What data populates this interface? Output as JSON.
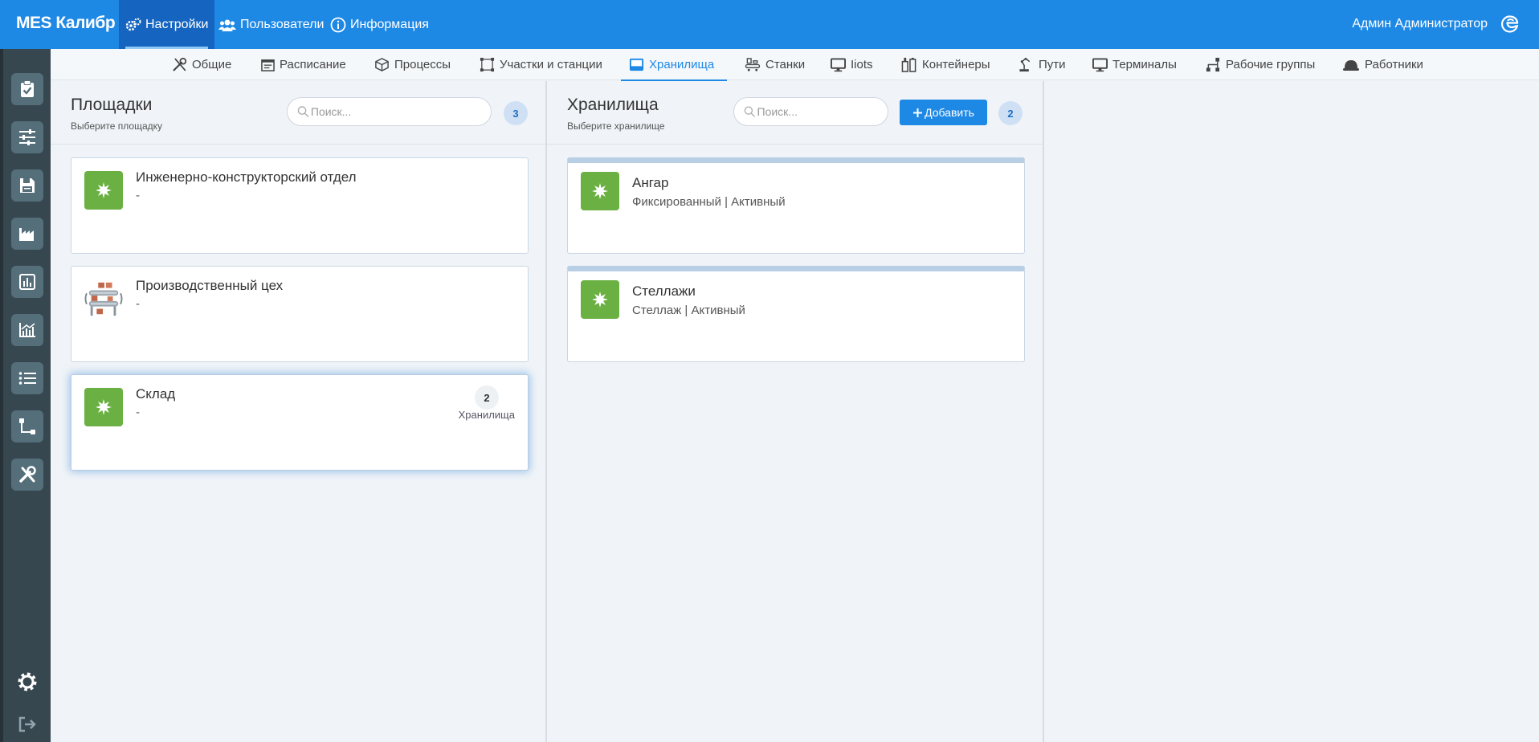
{
  "app": {
    "brand": "MES Калибр"
  },
  "topnav": [
    {
      "label": "Настройки",
      "icon": "gears-icon",
      "active": true
    },
    {
      "label": "Пользователи",
      "icon": "users-icon",
      "active": false
    },
    {
      "label": "Информация",
      "icon": "info-icon",
      "active": false
    }
  ],
  "user": {
    "name": "Админ Администратор",
    "icon": "edge-icon"
  },
  "sidebar": [
    {
      "icon": "clipboard-check-icon"
    },
    {
      "icon": "sliders-icon"
    },
    {
      "icon": "save-icon"
    },
    {
      "icon": "factory-icon"
    },
    {
      "icon": "bar-chart-icon"
    },
    {
      "icon": "line-chart-icon"
    },
    {
      "icon": "list-icon"
    },
    {
      "icon": "route-icon"
    },
    {
      "icon": "tools-icon"
    },
    {
      "icon": "settings-icon"
    },
    {
      "icon": "logout-icon"
    }
  ],
  "tabs": [
    {
      "label": "Общие",
      "icon": "tools-icon"
    },
    {
      "label": "Расписание",
      "icon": "calendar-icon"
    },
    {
      "label": "Процессы",
      "icon": "cube-icon"
    },
    {
      "label": "Участки и станции",
      "icon": "vector-square-icon"
    },
    {
      "label": "Хранилища",
      "icon": "inbox-icon",
      "active": true
    },
    {
      "label": "Станки",
      "icon": "conveyor-icon"
    },
    {
      "label": "Iiots",
      "icon": "monitor-icon"
    },
    {
      "label": "Контейнеры",
      "icon": "containers-icon"
    },
    {
      "label": "Пути",
      "icon": "robot-arm-icon"
    },
    {
      "label": "Терминалы",
      "icon": "desktop-icon"
    },
    {
      "label": "Рабочие группы",
      "icon": "network-icon"
    },
    {
      "label": "Работники",
      "icon": "hard-hat-icon"
    }
  ],
  "sites": {
    "title": "Площадки",
    "subtitle": "Выберите площадку",
    "search_placeholder": "Поиск...",
    "count": "3",
    "items": [
      {
        "title": "Инженерно-конструкторский отдел",
        "subtitle": "-",
        "icon": "star-burst-icon"
      },
      {
        "title": "Производственный цех",
        "subtitle": "-",
        "icon": "conveyor-illustration-icon"
      },
      {
        "title": "Склад",
        "subtitle": "-",
        "icon": "star-burst-icon",
        "selected": true,
        "count": "2",
        "count_label": "Хранилища"
      }
    ]
  },
  "storages": {
    "title": "Хранилища",
    "subtitle": "Выберите хранилище",
    "search_placeholder": "Поиск...",
    "add_label": "Добавить",
    "count": "2",
    "items": [
      {
        "title": "Ангар",
        "subtitle": "Фиксированный | Активный",
        "icon": "star-burst-icon"
      },
      {
        "title": "Стеллажи",
        "subtitle": "Стеллаж | Активный",
        "icon": "star-burst-icon"
      }
    ]
  },
  "colors": {
    "primary": "#1e88e5",
    "card_icon": "#6ab042",
    "sidebar": "#37474f"
  }
}
